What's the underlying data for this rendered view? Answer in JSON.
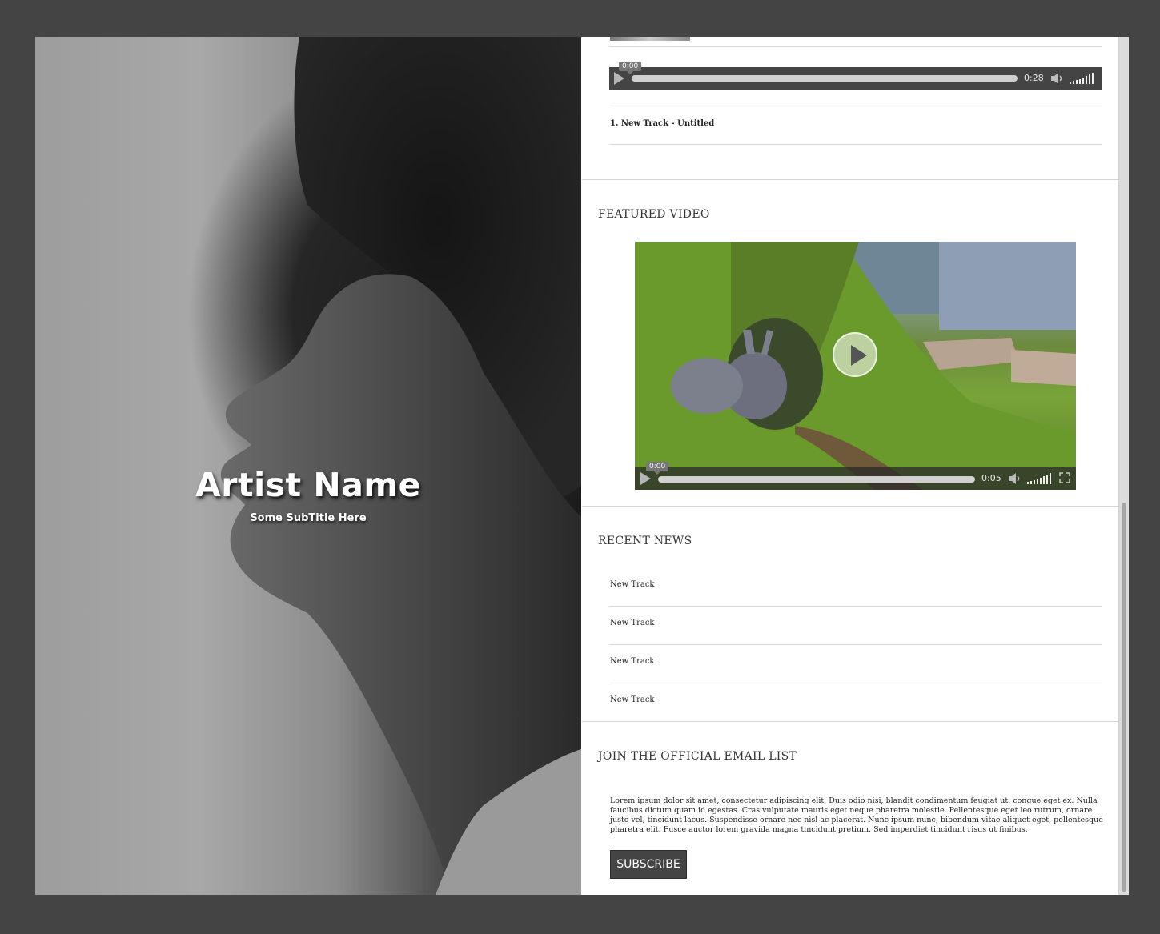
{
  "hero": {
    "artist_name": "Artist Name",
    "subtitle": "Some SubTitle Here"
  },
  "audio_player": {
    "current_time": "0:00",
    "duration": "0:28",
    "progress": 0.0
  },
  "playlist": {
    "tracks": [
      "1. New Track - Untitled"
    ]
  },
  "featured_video": {
    "title": "FEATURED VIDEO",
    "current_time": "0:00",
    "duration": "0:05",
    "progress": 0.0
  },
  "recent_news": {
    "title": "RECENT NEWS",
    "items": [
      "New Track",
      "New Track",
      "New Track",
      "New Track"
    ]
  },
  "email_list": {
    "title": "JOIN THE OFFICIAL EMAIL LIST",
    "body": "Lorem ipsum dolor sit amet, consectetur adipiscing elit. Duis odio nisi, blandit condimentum feugiat ut, congue eget ex. Nulla faucibus dictum quam id egestas. Cras vulputate mauris eget neque pharetra molestie. Pellentesque eget leo rutrum, ornare justo vel, tincidunt lacus. Suspendisse ornare nec nisl ac placerat. Nunc ipsum nunc, bibendum vitae aliquet eget, pellentesque pharetra elit. Fusce auctor lorem gravida magna tincidunt pretium. Sed imperdiet tincidunt risus ut finibus.",
    "button_label": "SUBSCRIBE"
  },
  "colors": {
    "page_background": "#444444",
    "player_background": "#444444",
    "button_background": "#444444"
  }
}
